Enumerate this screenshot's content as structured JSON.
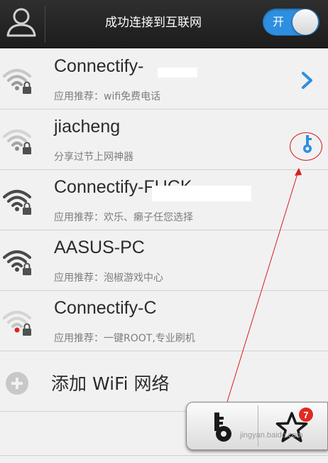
{
  "header": {
    "title": "成功连接到互联网",
    "toggle_label": "开"
  },
  "networks": [
    {
      "ssid": "Connectify-",
      "subtitle": "应用推荐：wifi免费电话",
      "signal": "strong-faded",
      "action": "chevron-right-icon"
    },
    {
      "ssid": "jiacheng",
      "subtitle": "分享过节上网神器",
      "signal": "medium-faded",
      "action": "key-icon"
    },
    {
      "ssid": "Connectify-FUCK",
      "subtitle": "应用推荐：欢乐、癞子任您选择",
      "signal": "full",
      "action": ""
    },
    {
      "ssid": "AASUS-PC",
      "subtitle": "应用推荐：泡椒游戏中心",
      "signal": "full",
      "action": ""
    },
    {
      "ssid": "Connectify-C",
      "subtitle": "应用推荐：一键ROOT,专业刷机",
      "signal": "weak-faded",
      "action": ""
    }
  ],
  "add_wifi": {
    "label": "添加 WiFi 网络"
  },
  "bottom_panel": {
    "badge_count": "7"
  },
  "watermark": "jingyan.baidu.com",
  "colors": {
    "accent": "#2e8fe0",
    "header_bg": "#262626",
    "badge": "#e12a24",
    "annotation": "#d81e1e"
  }
}
